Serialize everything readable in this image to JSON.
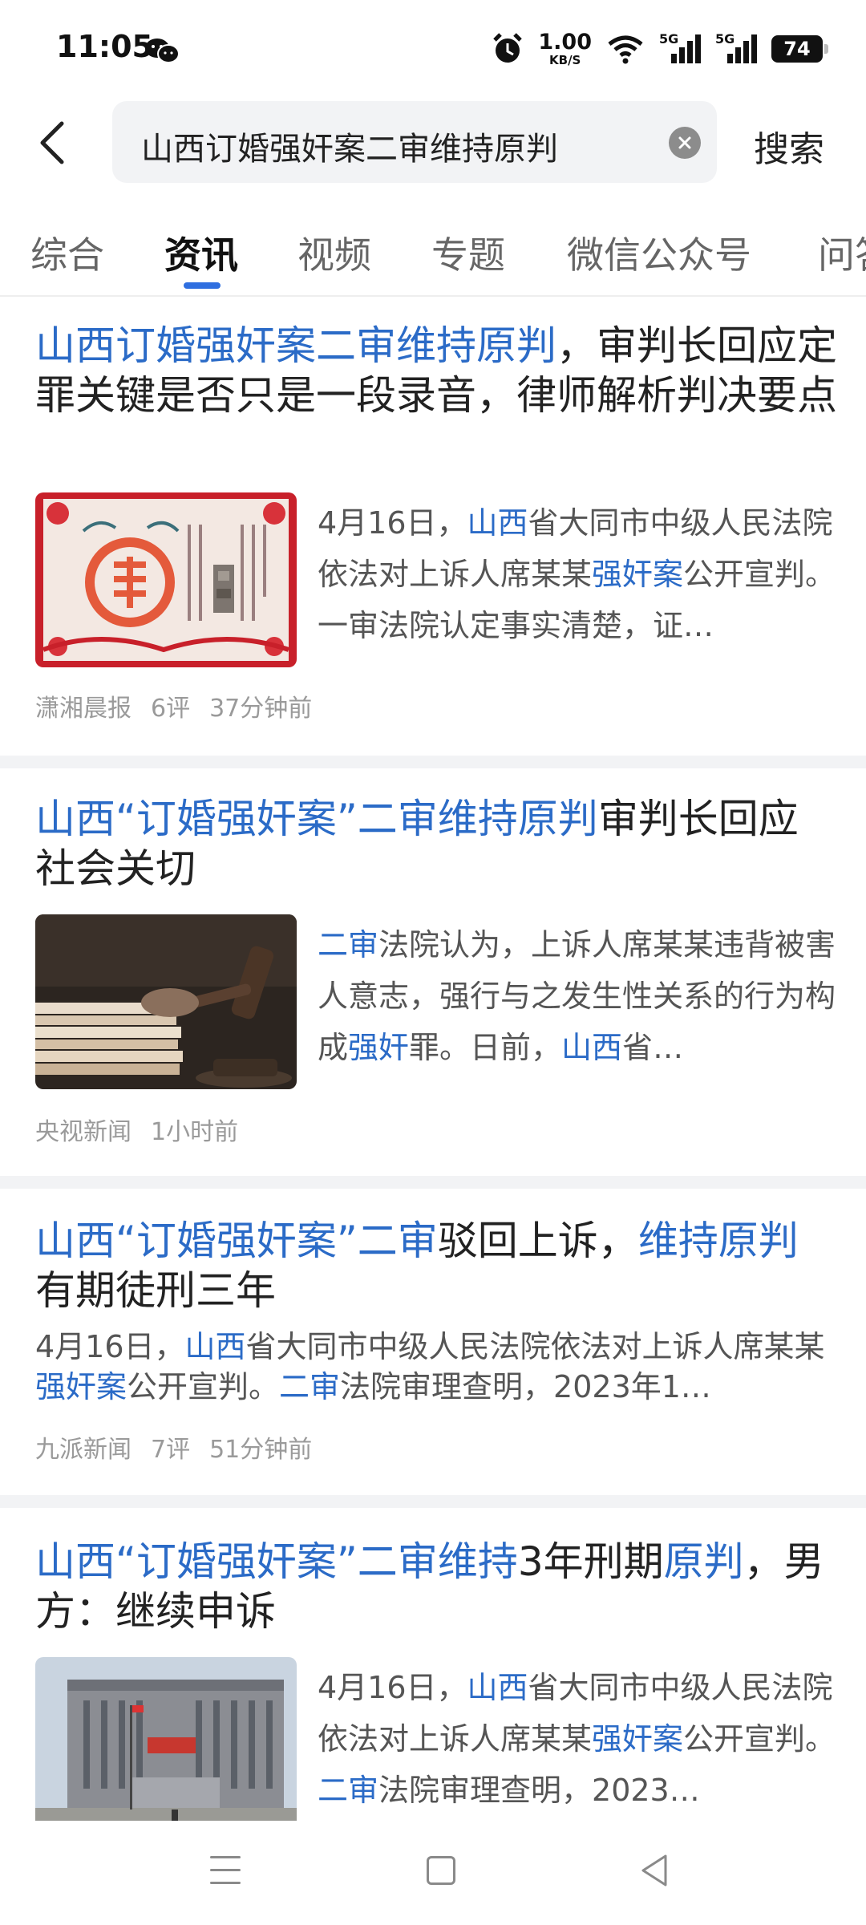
{
  "status_bar": {
    "time": "11:05",
    "net_speed_value": "1.00",
    "net_speed_unit": "KB/S",
    "signal_1_label": "5G",
    "signal_2_label": "5G",
    "battery": "74"
  },
  "search": {
    "query": "山西订婚强奸案二审维持原判",
    "button_label": "搜索"
  },
  "tabs": [
    {
      "label": "综合",
      "active": false
    },
    {
      "label": "资讯",
      "active": true
    },
    {
      "label": "视频",
      "active": false
    },
    {
      "label": "专题",
      "active": false
    },
    {
      "label": "微信公众号",
      "active": false
    },
    {
      "label": "问答",
      "active": false
    }
  ],
  "articles": [
    {
      "title_parts": [
        {
          "text": "山西订婚强奸案二审维持原判",
          "hl": true
        },
        {
          "text": "，审判长回应定罪关键是否只是一段录音，律师解析判决要点",
          "hl": false
        }
      ],
      "thumb": "marriage-certificate-image",
      "snippet_parts": [
        {
          "text": "4月16日，",
          "hl": false
        },
        {
          "text": "山西",
          "hl": true
        },
        {
          "text": "省大同市中级人民法院依法对上诉人席某某",
          "hl": false
        },
        {
          "text": "强奸案",
          "hl": true
        },
        {
          "text": "公开宣判。一审法院认定事实清楚，证…",
          "hl": false
        }
      ],
      "source": "潇湘晨报",
      "comments": "6评",
      "time": "37分钟前"
    },
    {
      "title_parts": [
        {
          "text": "山西“订婚强奸案”二审维持原判",
          "hl": true
        },
        {
          "text": "审判长回应社会关切",
          "hl": false
        }
      ],
      "thumb": "gavel-image",
      "snippet_parts": [
        {
          "text": "二审",
          "hl": true
        },
        {
          "text": "法院认为，上诉人席某某违背被害人意志，强行与之发生性关系的行为构成",
          "hl": false
        },
        {
          "text": "强奸",
          "hl": true
        },
        {
          "text": "罪。日前，",
          "hl": false
        },
        {
          "text": "山西",
          "hl": true
        },
        {
          "text": "省…",
          "hl": false
        }
      ],
      "source": "央视新闻",
      "comments": "",
      "time": "1小时前"
    },
    {
      "title_parts": [
        {
          "text": "山西“订婚强奸案”二审",
          "hl": true
        },
        {
          "text": "驳回上诉，",
          "hl": false
        },
        {
          "text": "维持原判",
          "hl": true
        },
        {
          "text": "有期徒刑三年",
          "hl": false
        }
      ],
      "thumb": "",
      "snippet_parts": [
        {
          "text": "4月16日，",
          "hl": false
        },
        {
          "text": "山西",
          "hl": true
        },
        {
          "text": "省大同市中级人民法院依法对上诉人席某某",
          "hl": false
        },
        {
          "text": "强奸案",
          "hl": true
        },
        {
          "text": "公开宣判。",
          "hl": false
        },
        {
          "text": "二审",
          "hl": true
        },
        {
          "text": "法院审理查明，2023年1…",
          "hl": false
        }
      ],
      "source": "九派新闻",
      "comments": "7评",
      "time": "51分钟前"
    },
    {
      "title_parts": [
        {
          "text": "山西“订婚强奸案”二审维持",
          "hl": true
        },
        {
          "text": "3年刑期",
          "hl": false
        },
        {
          "text": "原判",
          "hl": true
        },
        {
          "text": "，男方：继续申诉",
          "hl": false
        }
      ],
      "thumb": "courthouse-image",
      "snippet_parts": [
        {
          "text": "4月16日，",
          "hl": false
        },
        {
          "text": "山西",
          "hl": true
        },
        {
          "text": "省大同市中级人民法院依法对上诉人席某某",
          "hl": false
        },
        {
          "text": "强奸案",
          "hl": true
        },
        {
          "text": "公开宣判。",
          "hl": false
        },
        {
          "text": "二审",
          "hl": true
        },
        {
          "text": "法院审理查明，2023…",
          "hl": false
        }
      ],
      "source": "",
      "comments": "",
      "time": ""
    }
  ],
  "colors": {
    "highlight": "#2b6bc7",
    "tab_indicator": "#2f6fe0",
    "separator": "#f2f3f5"
  },
  "icons": [
    "wechat-icon",
    "alarm-icon",
    "wifi-icon",
    "signal-icon",
    "battery-icon",
    "back-arrow-icon",
    "clear-icon",
    "nav-menu-icon",
    "nav-home-icon",
    "nav-back-icon"
  ]
}
